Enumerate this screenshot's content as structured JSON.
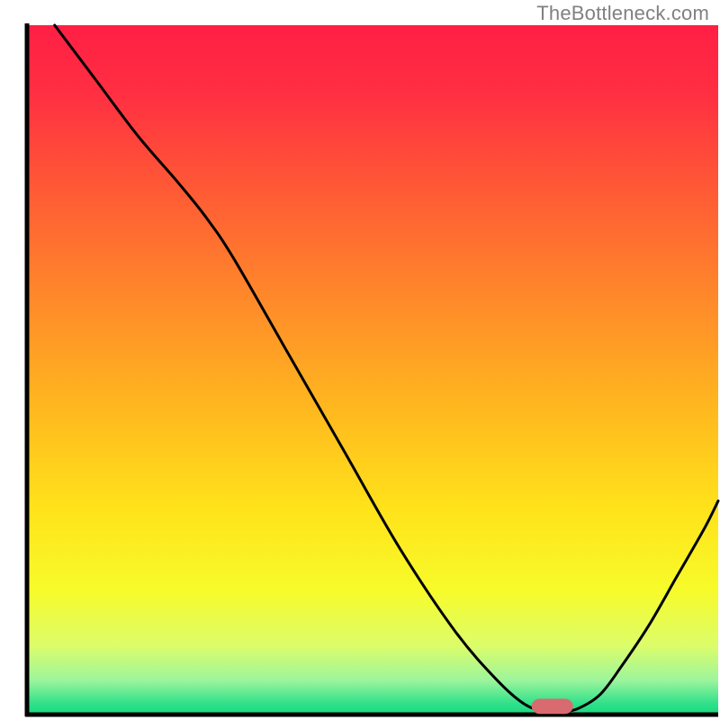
{
  "watermark": "TheBottleneck.com",
  "chart_data": {
    "type": "line",
    "title": "",
    "xlabel": "",
    "ylabel": "",
    "xlim": [
      0,
      100
    ],
    "ylim": [
      0,
      100
    ],
    "grid": false,
    "legend": false,
    "gradient_stops": [
      {
        "offset": 0.0,
        "color": "#ff1f44"
      },
      {
        "offset": 0.1,
        "color": "#ff2f42"
      },
      {
        "offset": 0.25,
        "color": "#ff5d34"
      },
      {
        "offset": 0.4,
        "color": "#ff8a2a"
      },
      {
        "offset": 0.55,
        "color": "#ffb61f"
      },
      {
        "offset": 0.7,
        "color": "#ffe21a"
      },
      {
        "offset": 0.82,
        "color": "#f7fb2a"
      },
      {
        "offset": 0.9,
        "color": "#dcfd6a"
      },
      {
        "offset": 0.95,
        "color": "#9df59c"
      },
      {
        "offset": 0.985,
        "color": "#2ee08a"
      },
      {
        "offset": 1.0,
        "color": "#16d97f"
      }
    ],
    "series": [
      {
        "name": "bottleneck-curve",
        "color": "#000000",
        "width": 3,
        "x": [
          4,
          10,
          16,
          22,
          26,
          30,
          38,
          46,
          54,
          62,
          68,
          72,
          75,
          78,
          80,
          83,
          86,
          90,
          94,
          98,
          100
        ],
        "y": [
          100,
          92,
          84,
          77,
          72,
          66,
          52,
          38,
          24,
          12,
          5,
          1.5,
          0.5,
          0.5,
          1,
          3,
          7,
          13,
          20,
          27,
          31
        ]
      }
    ],
    "marker": {
      "name": "optimal-marker",
      "x": 76,
      "y": 1.2,
      "width": 6,
      "height": 2.2,
      "color": "#d96a6f",
      "rx": 1.2
    },
    "axes": {
      "color": "#000000",
      "width": 5,
      "left_x": 3.5,
      "bottom_y": 0,
      "top_y": 100,
      "right_x": 100
    }
  }
}
